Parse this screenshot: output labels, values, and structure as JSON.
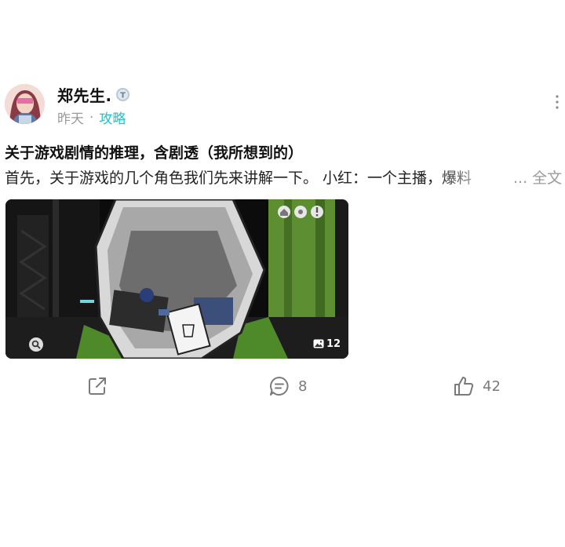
{
  "author": {
    "name": "郑先生.",
    "badge_icon": "verified-badge-icon",
    "badge_text": "T"
  },
  "meta": {
    "time": "昨天",
    "separator": "·",
    "category": "攻略"
  },
  "post": {
    "title": "关于游戏剧情的推理，含剧透（我所想到的）",
    "excerpt": "首先，关于游戏的几个角色我们先来讲解一下。 小红：一个主播，爆料",
    "read_more": "... 全文",
    "image": {
      "count": "12",
      "zoom_icon": "search-icon",
      "count_icon": "image-gallery-icon"
    }
  },
  "actions": {
    "share_icon": "share-icon",
    "comment_icon": "comment-icon",
    "comment_count": "8",
    "like_icon": "thumbs-up-icon",
    "like_count": "42"
  },
  "colors": {
    "accent": "#1ec2c9",
    "muted": "#9a9a9a",
    "icon": "#7a7a7a"
  }
}
